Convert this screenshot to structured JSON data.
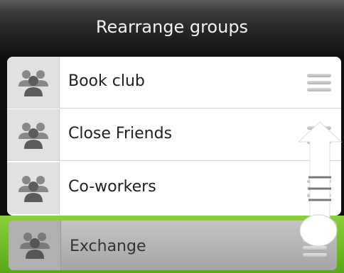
{
  "title_bar": {
    "title": "Rearrange groups"
  },
  "groups": [
    {
      "label": "Book club",
      "icon": "people-icon"
    },
    {
      "label": "Close Friends",
      "icon": "people-icon"
    },
    {
      "label": "Co-workers",
      "icon": "people-icon"
    }
  ],
  "dragging": {
    "label": "Exchange",
    "icon": "people-icon"
  },
  "colors": {
    "drag_highlight": "#7cc22a"
  }
}
